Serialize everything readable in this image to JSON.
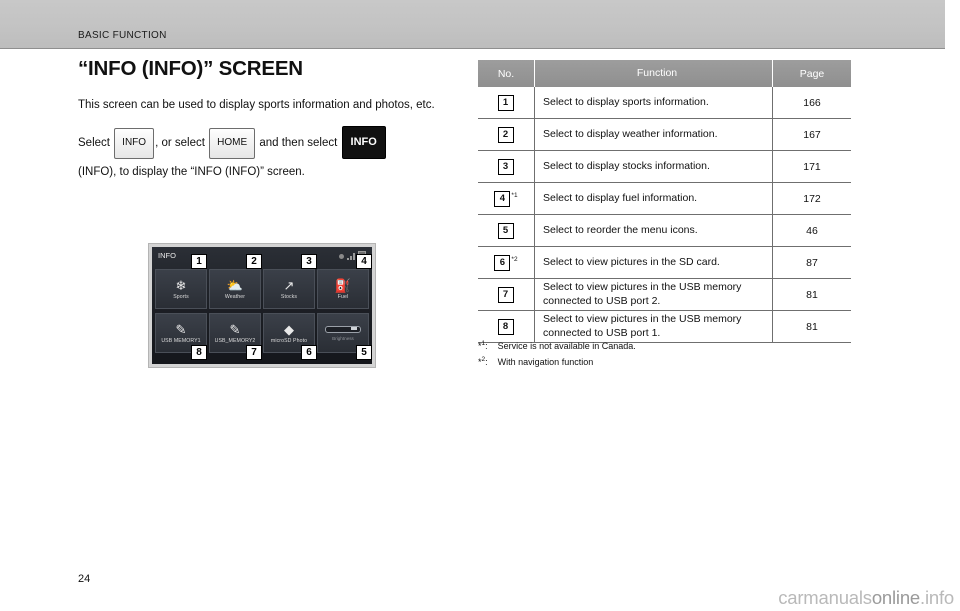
{
  "header": {
    "breadcrumb": "BASIC FUNCTION"
  },
  "left": {
    "title": "“INFO (INFO)” SCREEN",
    "para1": "This screen can be used to display sports information and photos, etc.",
    "para2_a": "Select",
    "btn_info": "INFO",
    "para2_b": ", or select",
    "btn_home": "HOME",
    "para2_c": "and then select",
    "btn_info_dark": "INFO",
    "para2_d": "(INFO), to display the “INFO (INFO)” screen."
  },
  "device": {
    "title": "INFO",
    "tiles": [
      {
        "icon": "❄",
        "label": "Sports",
        "badge": "1"
      },
      {
        "icon": "⛅",
        "label": "Weather",
        "badge": "2"
      },
      {
        "icon": "↗",
        "label": "Stocks",
        "badge": "3"
      },
      {
        "icon": "⛽",
        "label": "Fuel",
        "badge": "4"
      },
      {
        "icon": "✎",
        "label": "USB MEMORY1",
        "badge": "8"
      },
      {
        "icon": "✎",
        "label": "USB_MEMORY2",
        "badge": "7"
      },
      {
        "icon": "◆",
        "label": "microSD Photo",
        "badge": "6"
      }
    ],
    "slider_label": "Brightness",
    "slider_badge": "5"
  },
  "table": {
    "headers": [
      "No.",
      "Function",
      "Page"
    ],
    "rows": [
      {
        "no": "1",
        "sup": "",
        "function": "Select to display sports information.",
        "page": "166"
      },
      {
        "no": "2",
        "sup": "",
        "function": "Select to display weather information.",
        "page": "167"
      },
      {
        "no": "3",
        "sup": "",
        "function": "Select to display stocks information.",
        "page": "171"
      },
      {
        "no": "4",
        "sup": "*1",
        "function": "Select to display fuel information.",
        "page": "172"
      },
      {
        "no": "5",
        "sup": "",
        "function": "Select to reorder the menu icons.",
        "page": "46"
      },
      {
        "no": "6",
        "sup": "*2",
        "function": "Select to view pictures in the SD card.",
        "page": "87"
      },
      {
        "no": "7",
        "sup": "",
        "function": "Select to view pictures in the USB memory connected to USB port 2.",
        "page": "81"
      },
      {
        "no": "8",
        "sup": "",
        "function": "Select to view pictures in the USB memory connected to USB port 1.",
        "page": "81"
      }
    ]
  },
  "footnotes": [
    {
      "mark": "*",
      "sup": "1",
      "colon": ":",
      "text": "Service is not available in Canada."
    },
    {
      "mark": "*",
      "sup": "2",
      "colon": ":",
      "text": "With navigation function"
    }
  ],
  "footer": {
    "page_number": "24",
    "watermark_a": "carmanuals",
    "watermark_b": "online",
    "watermark_c": ".info"
  }
}
